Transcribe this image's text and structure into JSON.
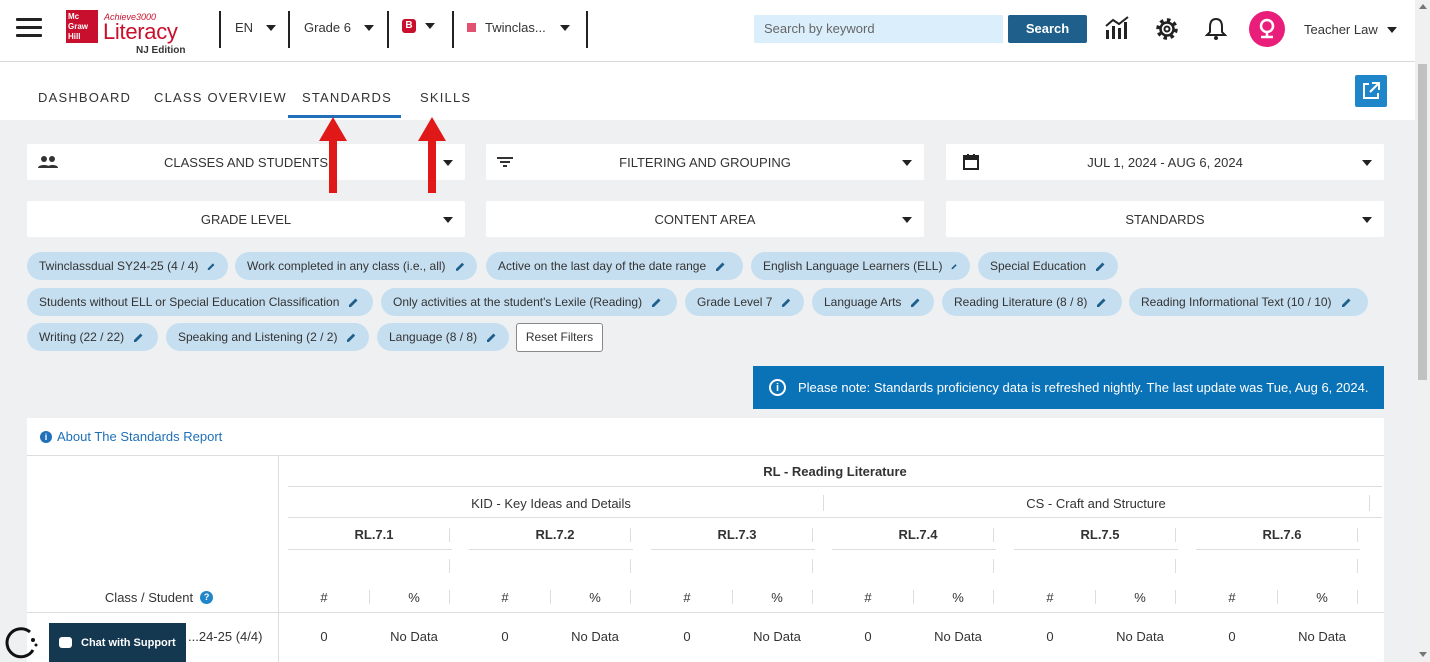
{
  "header": {
    "logo": {
      "box_text": "Mc Graw Hill",
      "achieve": "Achieve3000",
      "literacy": "Literacy",
      "edition": "NJ Edition"
    },
    "language": "EN",
    "grade": "Grade 6",
    "badge": "B",
    "class_name": "Twinclas...",
    "search_placeholder": "Search by keyword",
    "search_button": "Search",
    "user_name": "Teacher Law"
  },
  "tabs": [
    "DASHBOARD",
    "CLASS OVERVIEW",
    "STANDARDS",
    "SKILLS"
  ],
  "active_tab": "STANDARDS",
  "filters": {
    "classes": "CLASSES AND STUDENTS",
    "filtering": "FILTERING AND GROUPING",
    "date_range": "JUL 1, 2024 - AUG 6, 2024",
    "grade_level": "GRADE LEVEL",
    "content_area": "CONTENT AREA",
    "standards": "STANDARDS"
  },
  "chips": [
    "Twinclassdual SY24-25 (4 / 4)",
    "Work completed in any class (i.e., all)",
    "Active on the last day of the date range",
    "English Language Learners (ELL)",
    "Special Education",
    "Students without ELL or Special Education Classification",
    "Only activities at the student's Lexile (Reading)",
    "Grade Level 7",
    "Language Arts",
    "Reading Literature (8 / 8)",
    "Reading Informational Text (10 / 10)",
    "Writing (22 / 22)",
    "Speaking and Listening (2 / 2)",
    "Language (8 / 8)"
  ],
  "reset_filters": "Reset Filters",
  "notice": "Please note: Standards proficiency data is refreshed nightly. The last update was Tue, Aug 6, 2024.",
  "about_link": "About The Standards Report",
  "table": {
    "domain": "RL - Reading Literature",
    "clusters": [
      "KID - Key Ideas and Details",
      "CS - Craft and Structure"
    ],
    "standards": [
      "RL.7.1",
      "RL.7.2",
      "RL.7.3",
      "RL.7.4",
      "RL.7.5",
      "RL.7.6"
    ],
    "row_header": "Class / Student",
    "col_count": "#",
    "col_percent": "%",
    "rows": [
      {
        "name": "...24-25 (4/4)",
        "values": [
          "0",
          "No Data",
          "0",
          "No Data",
          "0",
          "No Data",
          "0",
          "No Data",
          "0",
          "No Data",
          "0",
          "No Data"
        ]
      }
    ]
  },
  "chat_support": "Chat with Support",
  "colors": {
    "brand_red": "#c8102e",
    "primary_blue": "#1f70b8",
    "notice_blue": "#0a72b6",
    "chip_bg": "#c6dff0",
    "annotation_arrow": "#e01818"
  }
}
